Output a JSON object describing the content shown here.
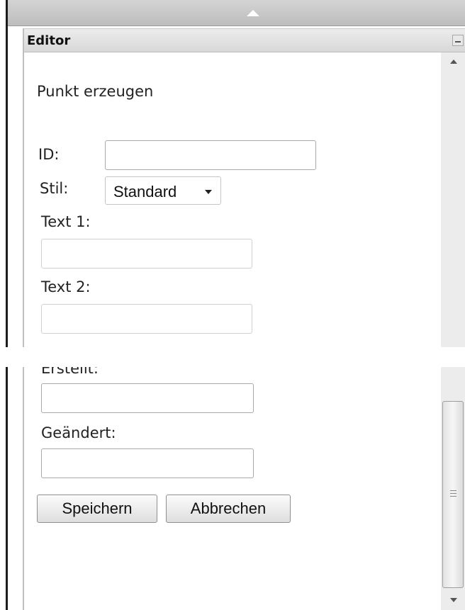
{
  "panel": {
    "title": "Editor"
  },
  "form": {
    "heading": "Punkt erzeugen",
    "id_label": "ID:",
    "id_value": "",
    "stil_label": "Stil:",
    "stil_selected": "Standard",
    "text1_label": "Text 1:",
    "text1_value": "",
    "text2_label": "Text 2:",
    "text2_value": "",
    "erstellt_label": "Erstellt:",
    "erstellt_value": "",
    "geaendert_label": "Geändert:",
    "geaendert_value": ""
  },
  "buttons": {
    "save_label": "Speichern",
    "cancel_label": "Abbrechen"
  },
  "icons": {
    "splitter": "triangle-up-icon",
    "minimize": "minimize-icon",
    "scroll_up": "arrow-up-icon",
    "scroll_down": "arrow-down-icon",
    "dropdown": "caret-down-icon"
  },
  "colors": {
    "header_bg": "#e0e0e0",
    "border_dark": "#1c1c1c",
    "input_border": "#a9a9a9",
    "button_bg": "#ececec"
  }
}
